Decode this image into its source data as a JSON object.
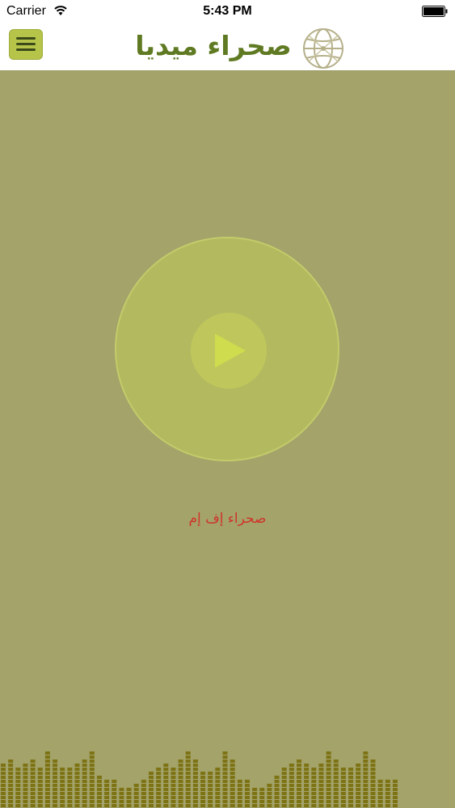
{
  "status_bar": {
    "carrier": "Carrier",
    "time": "5:43 PM",
    "icons": [
      "wifi-icon",
      "battery-icon"
    ]
  },
  "nav": {
    "menu_icon": "hamburger-menu-icon",
    "logo_text": "صحراء ميديا",
    "logo_icon": "globe-icon"
  },
  "player": {
    "station": "صحراء إف إم",
    "play_icon": "play-icon"
  },
  "equalizer": {
    "levels": [
      11,
      12,
      10,
      11,
      12,
      10,
      14,
      12,
      10,
      10,
      11,
      12,
      14,
      8,
      7,
      7,
      5,
      5,
      6,
      7,
      9,
      10,
      11,
      10,
      12,
      14,
      12,
      9,
      9,
      10,
      14,
      12,
      7,
      7,
      5,
      5,
      6,
      8,
      10,
      11,
      12,
      11,
      10,
      11,
      14,
      12,
      10,
      10,
      11,
      14,
      12,
      7,
      7,
      7
    ],
    "colors": {
      "on": "#7d7314",
      "off": "#9e9a5c",
      "background": "#a3a36a"
    }
  },
  "colors": {
    "accent": "#b7c44a",
    "logo_green": "#5f7a22",
    "station_text": "#d0342a"
  }
}
